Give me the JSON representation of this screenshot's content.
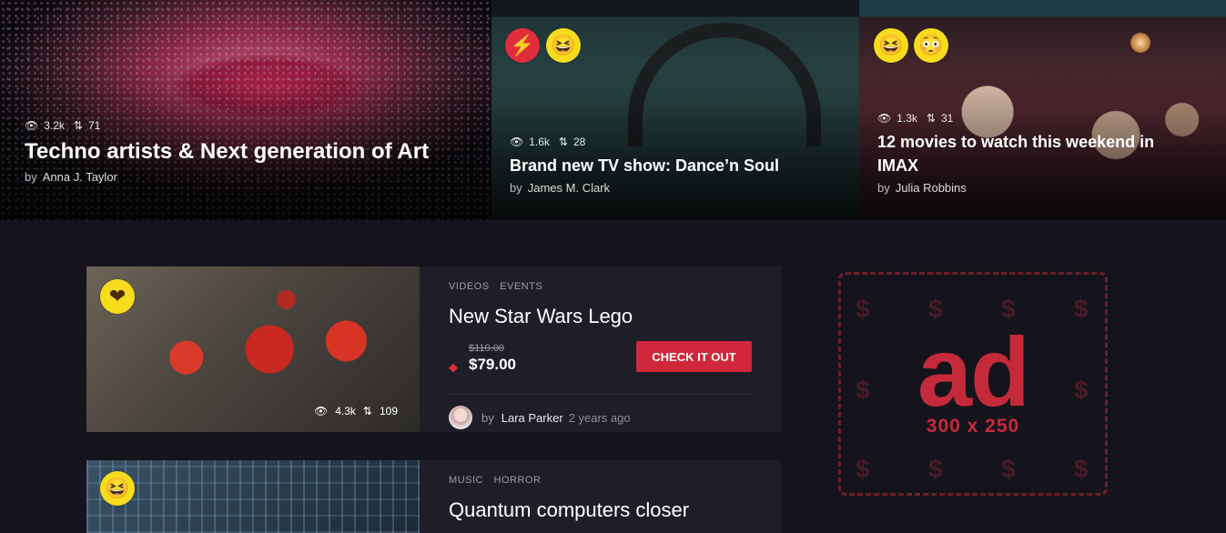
{
  "heroes": [
    {
      "views": "3.2k",
      "shares": "71",
      "title": "Techno artists & Next generation of Art",
      "by": "by",
      "author": "Anna J. Taylor",
      "reactions": []
    },
    {
      "views": "1.6k",
      "shares": "28",
      "title": "Brand new TV show: Dance’n Soul",
      "by": "by",
      "author": "James M. Clark",
      "reactions": [
        "flash-icon",
        "laughing-emoji-icon"
      ]
    },
    {
      "views": "1.3k",
      "shares": "31",
      "title": "12 movies to watch this weekend in IMAX",
      "by": "by",
      "author": "Julia Robbins",
      "reactions": [
        "laughing-emoji-icon",
        "shocked-emoji-icon"
      ]
    }
  ],
  "cards": [
    {
      "categories": [
        "VIDEOS",
        "EVENTS"
      ],
      "title": "New Star Wars Lego",
      "old_price": "$110.00",
      "new_price": "$79.00",
      "cta": "CHECK IT OUT",
      "views": "4.3k",
      "shares": "109",
      "by": "by",
      "author": "Lara Parker",
      "time_ago": "2 years ago",
      "reaction": "heart-emoji-icon"
    },
    {
      "categories": [
        "MUSIC",
        "HORROR"
      ],
      "title": "Quantum computers closer",
      "reaction": "laughing-emoji-icon"
    }
  ],
  "ad": {
    "label": "ad",
    "size": "300 x 250",
    "symbol": "$"
  },
  "colors": {
    "background": "#15141c",
    "card": "#1f1e28",
    "accent": "#d0283a",
    "emoji_yellow": "#f7dc1e"
  }
}
